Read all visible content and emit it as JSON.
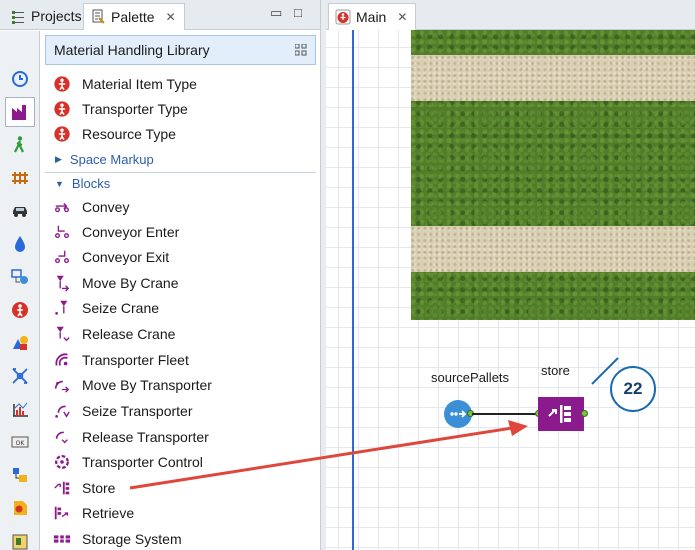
{
  "left_tabs": [
    {
      "label": "Projects"
    },
    {
      "label": "Palette"
    }
  ],
  "window_controls": {
    "minimize": "▭",
    "maximize": "□"
  },
  "library_title": "Material Handling Library",
  "type_items": [
    {
      "label": "Material Item Type"
    },
    {
      "label": "Transporter Type"
    },
    {
      "label": "Resource Type"
    }
  ],
  "sections": {
    "space_markup": "Space Markup",
    "blocks": "Blocks"
  },
  "blocks": [
    {
      "label": "Convey"
    },
    {
      "label": "Conveyor Enter"
    },
    {
      "label": "Conveyor Exit"
    },
    {
      "label": "Move By Crane"
    },
    {
      "label": "Seize Crane"
    },
    {
      "label": "Release Crane"
    },
    {
      "label": "Transporter Fleet"
    },
    {
      "label": "Move By Transporter"
    },
    {
      "label": "Seize Transporter"
    },
    {
      "label": "Release Transporter"
    },
    {
      "label": "Transporter Control"
    },
    {
      "label": "Store"
    },
    {
      "label": "Retrieve"
    },
    {
      "label": "Storage System"
    }
  ],
  "main_tab": {
    "label": "Main"
  },
  "canvas": {
    "source_label": "sourcePallets",
    "store_label": "store",
    "callout_number": "22"
  },
  "colors": {
    "accent_blue": "#2a6ad8",
    "block_purple": "#8b1a8c",
    "arrow_red": "#e0473c",
    "type_red": "#d6322a"
  },
  "category_icons": [
    "clock-icon",
    "factory-icon",
    "pedestrian-icon",
    "rail-icon",
    "car-icon",
    "fluid-icon",
    "process-icon",
    "agent-icon",
    "presentation-icon",
    "network-icon",
    "analysis-icon",
    "controls-icon",
    "connectivity-icon",
    "system-icon",
    "pictures-icon"
  ]
}
